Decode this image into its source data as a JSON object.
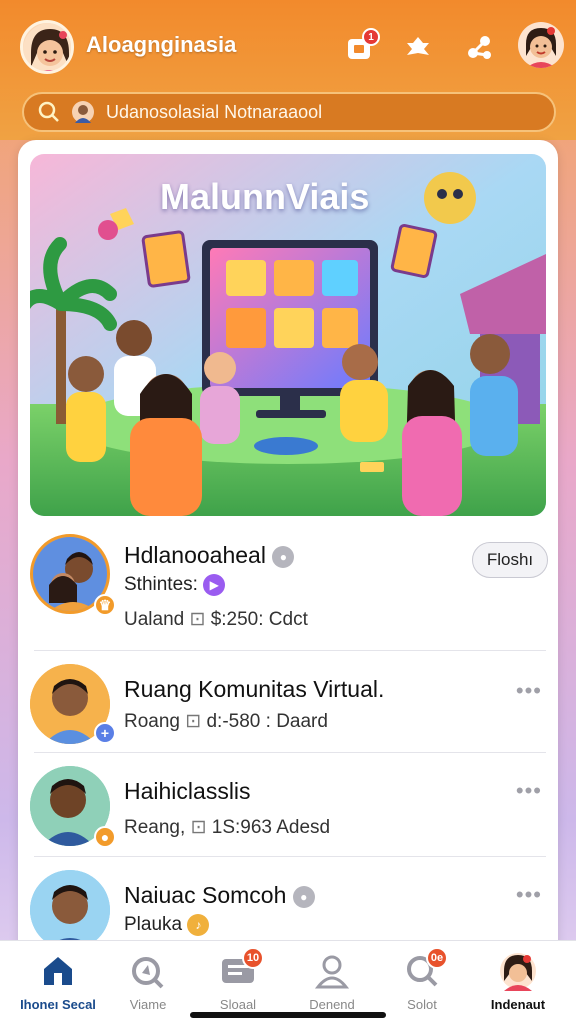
{
  "header": {
    "title": "Aloagnginasia",
    "notification_count": "1",
    "icons": [
      "user-avatar-icon",
      "notification-bell-icon",
      "puzzle-icon",
      "share-icon",
      "profile-icon"
    ]
  },
  "search": {
    "text": "Udanosolasial Notnaraaool"
  },
  "banner": {
    "title": "MalunnViais"
  },
  "feed": [
    {
      "title": "Hdlanooaheal",
      "subtitle": "Sthintes:",
      "meta_prefix": "Ualand",
      "meta_value": "$:250: Cdct",
      "action_label": "Floshı"
    },
    {
      "title": "Ruang Komunitas Virtual.",
      "meta_prefix": "Roang",
      "meta_value": "d:-580 : Daard"
    },
    {
      "title": "Haihiclasslis",
      "meta_prefix": "Reang,",
      "meta_value": "1S:963 Adesd"
    },
    {
      "title": "Naiuac Somcoh",
      "subtitle": "Plauka"
    }
  ],
  "bottom_nav": [
    {
      "label": "Ihoneı Secal",
      "icon": "home-icon",
      "active": true
    },
    {
      "label": "Viame",
      "icon": "explore-icon"
    },
    {
      "label": "Sloaal",
      "icon": "chat-icon",
      "badge": "10"
    },
    {
      "label": "Denend",
      "icon": "person-icon"
    },
    {
      "label": "Solot",
      "icon": "search-icon",
      "badge": "0e"
    },
    {
      "label": "Indenaut",
      "icon": "profile-icon",
      "active_label": true
    }
  ],
  "colors": {
    "header_orange": "#f28a2c",
    "accent_blue": "#1a4b8c",
    "badge_red": "#e8522c"
  }
}
